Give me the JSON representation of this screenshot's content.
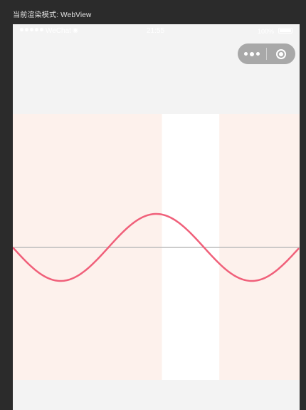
{
  "top_bar": {
    "render_mode_label": "当前渲染模式: WebView"
  },
  "status_bar": {
    "carrier": "WeChat",
    "time": "21:55",
    "battery": "100%"
  },
  "capsule": {
    "more_icon": "more-dots-icon",
    "close_icon": "target-circle-icon"
  },
  "colors": {
    "band_fill": "#fdf1ec",
    "highlight_fill": "#ffffff",
    "wave_stroke": "#f0607a",
    "baseline_stroke": "#bcbcbc"
  },
  "chart_data": {
    "type": "line",
    "wave": "sine",
    "periods_visible": 1.5,
    "highlight_range": [
      0.52,
      0.72
    ],
    "x_range": [
      0,
      1
    ],
    "y_range": [
      -1,
      1
    ]
  }
}
